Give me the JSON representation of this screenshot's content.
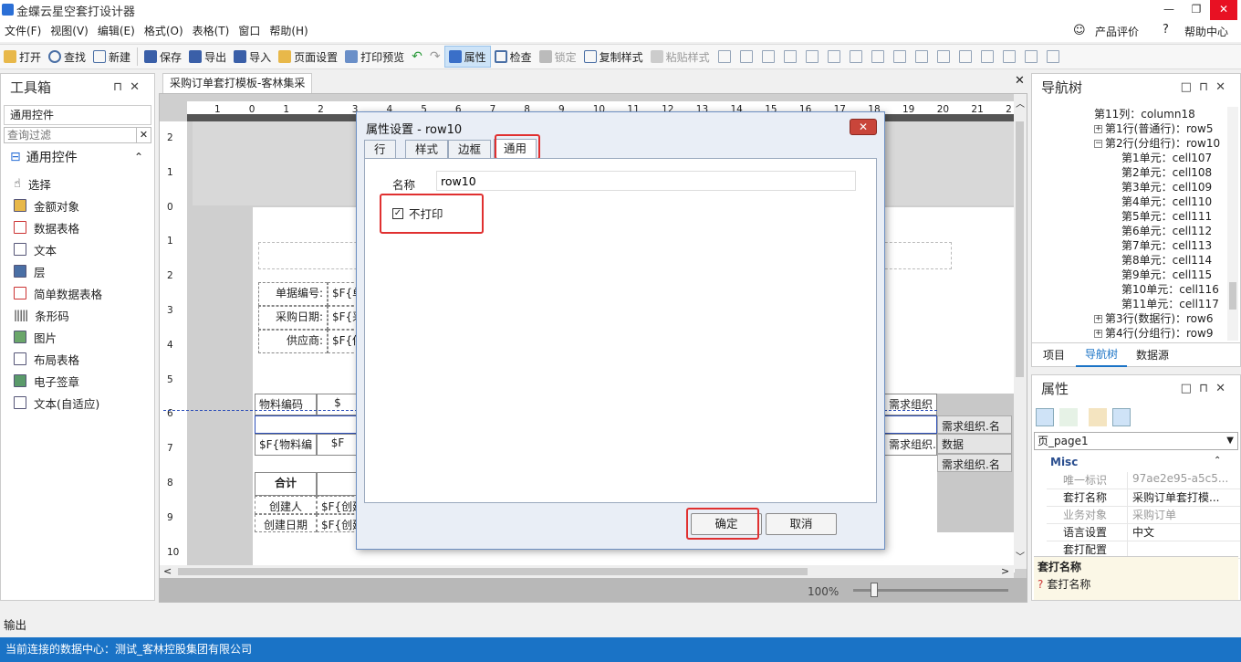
{
  "app": {
    "title": "金蝶云星空套打设计器"
  },
  "window_controls": {
    "minimize": "—",
    "restore": "❐",
    "close": "✕"
  },
  "menus": [
    "文件(F)",
    "视图(V)",
    "编辑(E)",
    "格式(O)",
    "表格(T)",
    "窗口",
    "帮助(H)"
  ],
  "top_right": {
    "rate": "产品评价",
    "help": "帮助中心"
  },
  "toolbar": {
    "open": "打开",
    "find": "查找",
    "new": "新建",
    "save": "保存",
    "export": "导出",
    "import": "导入",
    "page_setup": "页面设置",
    "print_preview": "打印预览",
    "properties": "属性",
    "check": "检查",
    "lock": "锁定",
    "copy_style": "复制样式",
    "paste_style": "粘贴样式"
  },
  "toolbox": {
    "title": "工具箱",
    "category": "通用控件",
    "filter_placeholder": "查询过滤",
    "group": "通用控件",
    "items": [
      "选择",
      "金额对象",
      "数据表格",
      "文本",
      "层",
      "简单数据表格",
      "条形码",
      "图片",
      "布局表格",
      "电子签章",
      "文本(自适应)"
    ]
  },
  "document": {
    "tab": "采购订单套打模板-客林集采",
    "ruler_h": [
      "1",
      "0",
      "1",
      "2",
      "3",
      "4",
      "5",
      "6",
      "7",
      "8",
      "9",
      "10",
      "11",
      "12",
      "13",
      "14",
      "15",
      "16",
      "17",
      "18",
      "19",
      "20",
      "21",
      "2"
    ],
    "ruler_v": [
      "2",
      "1",
      "0",
      "1",
      "2",
      "3",
      "4",
      "5",
      "6",
      "7",
      "8",
      "9",
      "10"
    ],
    "cells": {
      "bill_no": "单据编号:",
      "bill_no_v": "$F{单",
      "date": "采购日期:",
      "date_v": "$F{采",
      "supplier": "供应商:",
      "supplier_v": "$F{供",
      "material_code": "物料编码",
      "material_code_v": "$F{物料编",
      "col2": "$",
      "col2_v": "$F",
      "req_org": "需求组织",
      "req_org_v": "需求组织.",
      "req_org_name1": "需求组织.名",
      "data": "数据",
      "req_org_name2": "需求组织.名",
      "total": "合计",
      "creator": "创建人",
      "creator_v": "$F{创建",
      "created_date": "创建日期",
      "created_date_v": "$F{创建"
    },
    "zoom": "100%"
  },
  "dialog": {
    "title": "属性设置 - row10",
    "tabs": [
      "行",
      "样式",
      "边框",
      "通用"
    ],
    "active_tab": "通用",
    "name_label": "名称",
    "name_value": "row10",
    "no_print_label": "不打印",
    "no_print_checked": true,
    "ok": "确定",
    "cancel": "取消"
  },
  "nav_panel": {
    "title": "导航树",
    "nodes": [
      {
        "text": "第11列：column18",
        "indent": 0,
        "exp": ""
      },
      {
        "text": "第1行(普通行)：row5",
        "indent": 0,
        "exp": "+"
      },
      {
        "text": "第2行(分组行)：row10",
        "indent": 0,
        "exp": "-"
      },
      {
        "text": "第1单元：cell107",
        "indent": 1,
        "exp": ""
      },
      {
        "text": "第2单元：cell108",
        "indent": 1,
        "exp": ""
      },
      {
        "text": "第3单元：cell109",
        "indent": 1,
        "exp": ""
      },
      {
        "text": "第4单元：cell110",
        "indent": 1,
        "exp": ""
      },
      {
        "text": "第5单元：cell111",
        "indent": 1,
        "exp": ""
      },
      {
        "text": "第6单元：cell112",
        "indent": 1,
        "exp": ""
      },
      {
        "text": "第7单元：cell113",
        "indent": 1,
        "exp": ""
      },
      {
        "text": "第8单元：cell114",
        "indent": 1,
        "exp": ""
      },
      {
        "text": "第9单元：cell115",
        "indent": 1,
        "exp": ""
      },
      {
        "text": "第10单元：cell116",
        "indent": 1,
        "exp": ""
      },
      {
        "text": "第11单元：cell117",
        "indent": 1,
        "exp": ""
      },
      {
        "text": "第3行(数据行)：row6",
        "indent": 0,
        "exp": "+"
      },
      {
        "text": "第4行(分组行)：row9",
        "indent": 0,
        "exp": "+"
      }
    ],
    "tabs": [
      "项目",
      "导航树",
      "数据源"
    ],
    "active_tab": "导航树"
  },
  "prop_panel": {
    "title": "属性",
    "selector": "页_page1",
    "section": "Misc",
    "rows": [
      {
        "k": "唯一标识",
        "v": "97ae2e95-a5c5...",
        "dim": true
      },
      {
        "k": "套打名称",
        "v": "采购订单套打模...",
        "dim": false
      },
      {
        "k": "业务对象",
        "v": "采购订单",
        "dim": true
      },
      {
        "k": "语言设置",
        "v": "中文",
        "dim": false
      },
      {
        "k": "套打配置",
        "v": "",
        "dim": false
      }
    ],
    "desc_title": "套打名称",
    "desc_text": "套打名称"
  },
  "output_tab": "输出",
  "status": "当前连接的数据中心：测试_客林控股集团有限公司",
  "colors": {
    "accent": "#1a73c6",
    "highlight": "#e03030",
    "active_nav": "#1a73c6"
  }
}
